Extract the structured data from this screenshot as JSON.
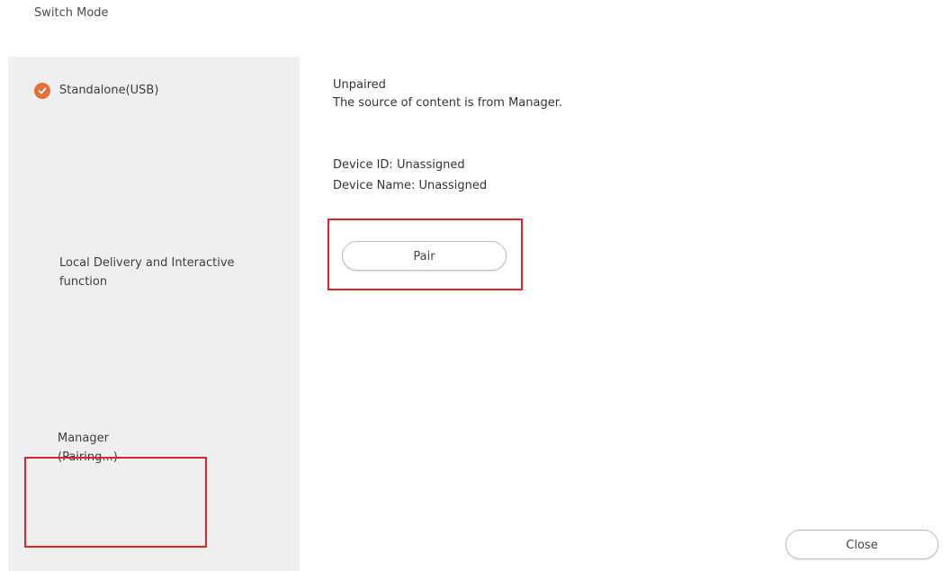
{
  "window": {
    "title": "Switch Mode"
  },
  "sidebar": {
    "items": [
      {
        "label": "Standalone(USB)",
        "selected": true,
        "icon": "check-circle-icon"
      },
      {
        "label": "Local Delivery and Interactive function",
        "selected": false
      },
      {
        "label": "Manager",
        "sublabel": "(Pairing...)",
        "selected": false
      }
    ]
  },
  "main": {
    "status_title": "Unpaired",
    "status_description": "The source of content is from Manager.",
    "device_id": "Device ID: Unassigned",
    "device_name": "Device Name: Unassigned",
    "pair_label": "Pair"
  },
  "footer": {
    "close_label": "Close"
  },
  "colors": {
    "accent": "#e2703a",
    "highlight": "#d9262a",
    "sidebar_bg": "#efefef"
  }
}
